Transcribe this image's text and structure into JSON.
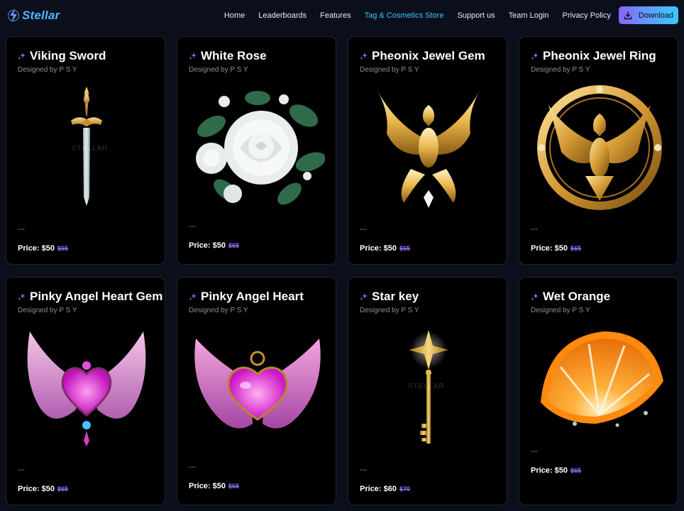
{
  "brand": {
    "name": "Stellar",
    "accent": "#4fb6ff"
  },
  "nav": {
    "links": [
      "Home",
      "Leaderboards",
      "Features",
      "Tag & Cosmetics Store",
      "Support us",
      "Team Login",
      "Privacy Policy"
    ],
    "active_index": 3,
    "download_label": "Download"
  },
  "cards": [
    {
      "title": "Viking Sword",
      "designer": "Designed by P S Y",
      "dash": "---",
      "price": "Price: $50",
      "old_price": "$65",
      "icon": "sword-icon",
      "watermark": "STELLAR"
    },
    {
      "title": "White Rose",
      "designer": "Designed by P S Y",
      "dash": "---",
      "price": "Price: $50",
      "old_price": "$65",
      "icon": "rose-icon"
    },
    {
      "title": "Pheonix Jewel Gem",
      "designer": "Designed by P S Y",
      "dash": "---",
      "price": "Price: $50",
      "old_price": "$65",
      "icon": "phoenix-gem-icon"
    },
    {
      "title": "Pheonix Jewel Ring",
      "designer": "Designed by P S Y",
      "dash": "---",
      "price": "Price: $50",
      "old_price": "$65",
      "icon": "phoenix-ring-icon"
    },
    {
      "title": "Pinky Angel Heart Gem",
      "designer": "Designed by P S Y",
      "dash": "---",
      "price": "Price: $50",
      "old_price": "$65",
      "icon": "angel-heart-gem-icon"
    },
    {
      "title": "Pinky Angel Heart",
      "designer": "Designed by P S Y",
      "dash": "---",
      "price": "Price: $50",
      "old_price": "$65",
      "icon": "angel-heart-icon"
    },
    {
      "title": "Star key",
      "designer": "Designed by P S Y",
      "dash": "---",
      "price": "Price: $60",
      "old_price": "$70",
      "icon": "star-key-icon",
      "watermark": "STELLAR"
    },
    {
      "title": "Wet Orange",
      "designer": "Designed by P S Y",
      "dash": "---",
      "price": "Price: $50",
      "old_price": "$65",
      "icon": "orange-icon"
    }
  ]
}
